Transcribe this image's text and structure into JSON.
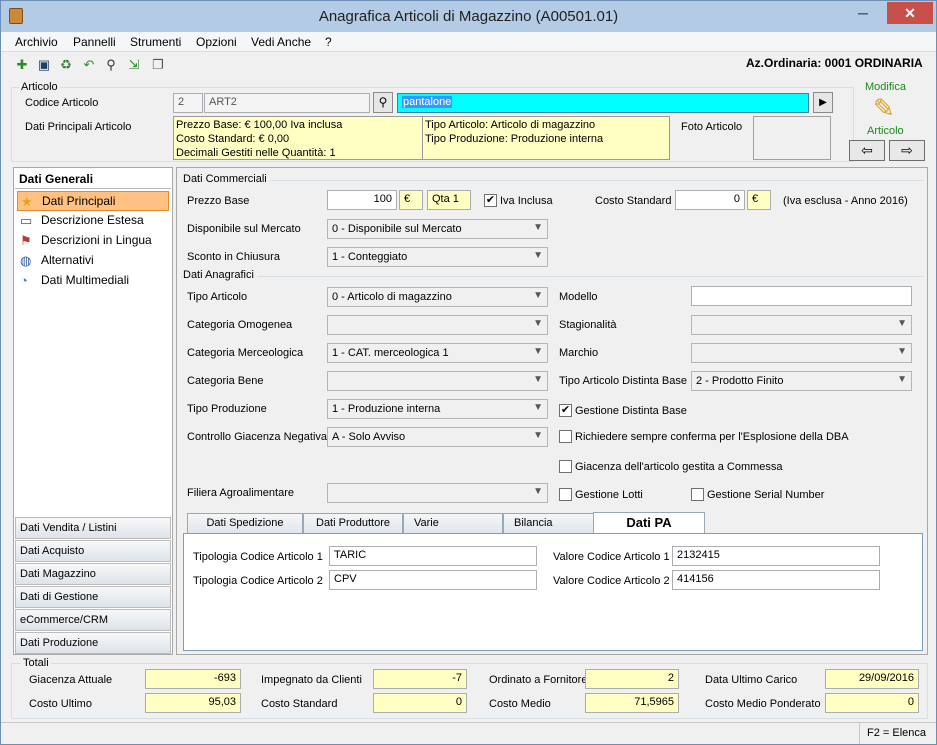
{
  "window": {
    "title": "Anagrafica Articoli di Magazzino (A00501.01)",
    "min": "─",
    "max": "☐",
    "close": "✕"
  },
  "menu": [
    "Archivio",
    "Pannelli",
    "Strumenti",
    "Opzioni",
    "Vedi Anche",
    "?"
  ],
  "toolbar": {
    "icons": [
      "new-icon",
      "save-icon",
      "delete-icon",
      "undo-icon",
      "find-icon",
      "export-icon",
      "copy-icon"
    ],
    "company": "Az.Ordinaria: 0001 ORDINARIA"
  },
  "articolo": {
    "group_label": "Articolo",
    "codice_label": "Codice Articolo",
    "codice_num": "2",
    "codice_val": "ART2",
    "search_value": "pantalone",
    "dati_label": "Dati Principali Articolo",
    "info_left": [
      "Prezzo Base: € 100,00 Iva inclusa",
      "Costo Standard: € 0,00",
      "Decimali Gestiti nelle Quantità: 1"
    ],
    "info_right": [
      "Tipo Articolo: Articolo di magazzino",
      "Tipo Produzione: Produzione interna"
    ],
    "foto_label": "Foto Articolo",
    "modifica_top": "Modifica",
    "modifica_bottom": "Articolo",
    "prev": "⇦",
    "next": "⇨"
  },
  "sidebar": {
    "header": "Dati Generali",
    "items": [
      {
        "label": "Dati Principali",
        "icon": "star-icon",
        "glyph": "★"
      },
      {
        "label": "Descrizione Estesa",
        "icon": "document-icon",
        "glyph": "▭"
      },
      {
        "label": "Descrizioni in Lingua",
        "icon": "flag-icon",
        "glyph": "⚑"
      },
      {
        "label": "Alternativi",
        "icon": "globe-icon",
        "glyph": "◍"
      },
      {
        "label": "Dati Multimediali",
        "icon": "media-icon",
        "glyph": "◔"
      }
    ],
    "groups": [
      "Dati Vendita / Listini",
      "Dati Acquisto",
      "Dati Magazzino",
      "Dati di Gestione",
      "eCommerce/CRM",
      "Dati Produzione"
    ]
  },
  "commerciali": {
    "title": "Dati Commerciali",
    "prezzo_label": "Prezzo Base",
    "prezzo": "100",
    "valuta": "€",
    "qta": "Qta 1",
    "iva_label": "Iva Inclusa",
    "iva_checked": "✔",
    "costo_label": "Costo Standard",
    "costo": "0",
    "costo_valuta": "€",
    "costo_note": "(Iva esclusa - Anno 2016)",
    "disp_label": "Disponibile sul Mercato",
    "disp": "0 - Disponibile sul Mercato",
    "sconto_label": "Sconto in Chiusura",
    "sconto": "1 - Conteggiato"
  },
  "anagrafici": {
    "title": "Dati Anagrafici",
    "tipo_label": "Tipo Articolo",
    "tipo": "0 - Articolo di magazzino",
    "catom_label": "Categoria Omogenea",
    "catom": "",
    "catmerc_label": "Categoria Merceologica",
    "catmerc": "1 - CAT. merceologica 1",
    "catbene_label": "Categoria Bene",
    "catbene": "",
    "tipoprod_label": "Tipo Produzione",
    "tipoprod": "1 - Produzione interna",
    "controllo_label": "Controllo Giacenza Negativa",
    "controllo": "A - Solo Avviso",
    "filiera_label": "Filiera Agroalimentare",
    "filiera": "",
    "modello_label": "Modello",
    "modello": "",
    "stag_label": "Stagionalità",
    "stag": "",
    "marchio_label": "Marchio",
    "marchio": "",
    "tipodb_label": "Tipo Articolo Distinta Base",
    "tipodb": "2 - Prodotto Finito",
    "chk_distinta": "Gestione Distinta Base",
    "chk_distinta_mark": "✔",
    "chk_conferma": "Richiedere sempre conferma per l'Esplosione della DBA",
    "chk_commessa": "Giacenza dell'articolo gestita a Commessa",
    "chk_lotti": "Gestione Lotti",
    "chk_serial": "Gestione Serial Number"
  },
  "tabs": [
    "Dati Spedizione",
    "Dati Produttore",
    "Varie",
    "Bilancia",
    "Dati PA"
  ],
  "pa": {
    "tip1_label": "Tipologia Codice Articolo 1",
    "tip1": "TARIC",
    "tip2_label": "Tipologia Codice Articolo 2",
    "tip2": "CPV",
    "val1_label": "Valore Codice Articolo 1",
    "val1": "2132415",
    "val2_label": "Valore Codice Articolo 2",
    "val2": "414156"
  },
  "totali": {
    "title": "Totali",
    "giacenza_label": "Giacenza Attuale",
    "giacenza": "-693",
    "impegnato_label": "Impegnato da Clienti",
    "impegnato": "-7",
    "ordinato_label": "Ordinato a Fornitore",
    "ordinato": "2",
    "data_label": "Data Ultimo Carico",
    "data": "29/09/2016",
    "costou_label": "Costo Ultimo",
    "costou": "95,03",
    "costos_label": "Costo Standard",
    "costos": "0",
    "costom_label": "Costo Medio",
    "costom": "71,5965",
    "costomp_label": "Costo Medio Ponderato",
    "costomp": "0"
  },
  "status": "F2 = Elenca"
}
